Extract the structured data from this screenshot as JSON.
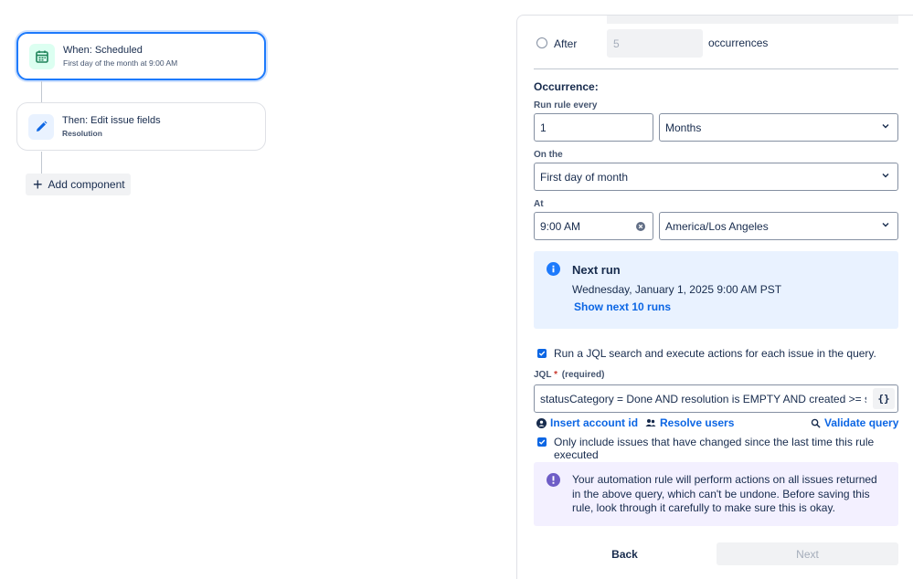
{
  "flow": {
    "trigger": {
      "title": "When: Scheduled",
      "subtitle": "First day of the month at 9:00 AM"
    },
    "action": {
      "title": "Then: Edit issue fields",
      "subtitle": "Resolution"
    },
    "add_component_label": "Add component"
  },
  "panel": {
    "ends": {
      "after_label": "After",
      "occurrences_value": "5",
      "occurrences_suffix": "occurrences"
    },
    "occurrence_heading": "Occurrence:",
    "run_rule_every": {
      "label": "Run rule every",
      "value": "1",
      "unit": "Months"
    },
    "on_the": {
      "label": "On the",
      "value": "First day of month"
    },
    "at": {
      "label": "At",
      "time": "9:00 AM",
      "timezone": "America/Los Angeles"
    },
    "next_run": {
      "title": "Next run",
      "datetime": "Wednesday, January 1, 2025 9:00 AM PST",
      "show_next": "Show next 10 runs"
    },
    "jql_checkbox_label": "Run a JQL search and execute actions for each issue in the query.",
    "jql": {
      "label": "JQL",
      "required_mark": "*",
      "required_text": "(required)",
      "value": "statusCategory = Done AND resolution is EMPTY AND created >= startOfM",
      "braces": "{}"
    },
    "links": {
      "insert_account": "Insert account id",
      "resolve_users": "Resolve users",
      "validate_query": "Validate query"
    },
    "only_include_label": "Only include issues that have changed since the last time this rule executed",
    "warning": "Your automation rule will perform actions on all issues returned in the above query, which can't be undone. Before saving this rule, look through it carefully to make sure this is okay.",
    "back_label": "Back",
    "next_label": "Next"
  },
  "colors": {
    "primary": "#0c66e4",
    "selected_border": "#1d7afc",
    "info_bg": "#e9f2ff",
    "warning_bg": "#f3f0ff",
    "warning_icon": "#6e5dc6"
  }
}
